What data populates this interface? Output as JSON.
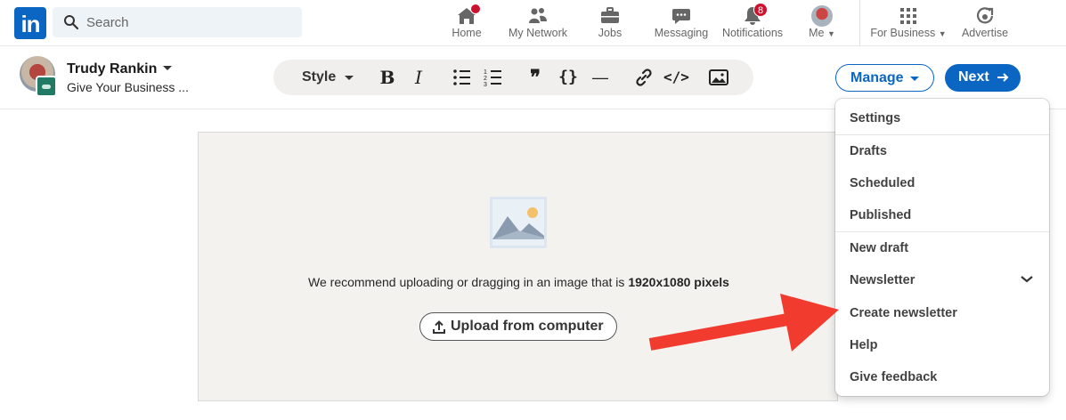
{
  "nav": {
    "logo_text": "in",
    "search_placeholder": "Search",
    "items": [
      {
        "label": "Home",
        "icon": "home-icon"
      },
      {
        "label": "My Network",
        "icon": "network-icon"
      },
      {
        "label": "Jobs",
        "icon": "briefcase-icon"
      },
      {
        "label": "Messaging",
        "icon": "message-icon"
      },
      {
        "label": "Notifications",
        "icon": "bell-icon",
        "badge": "8"
      },
      {
        "label": "Me",
        "icon": "avatar"
      },
      {
        "label": "For Business",
        "icon": "grid-icon"
      },
      {
        "label": "Advertise",
        "icon": "advertise-icon"
      }
    ]
  },
  "author": {
    "name": "Trudy Rankin",
    "subtitle": "Give Your Business ..."
  },
  "toolbar": {
    "style_label": "Style",
    "bold_glyph": "B",
    "italic_glyph": "I",
    "quote_glyph": "❞",
    "code_glyph": "{}",
    "divider_glyph": "—",
    "embed_glyph": "</>"
  },
  "header_actions": {
    "manage_label": "Manage",
    "next_label": "Next"
  },
  "canvas": {
    "recommend_text": "We recommend uploading or dragging in an image that is ",
    "recommend_bold": "1920x1080 pixels",
    "upload_label": "Upload from computer"
  },
  "menu": {
    "items": [
      "Settings",
      "Drafts",
      "Scheduled",
      "Published",
      "New draft",
      "Newsletter",
      "Create newsletter",
      "Help",
      "Give feedback"
    ]
  },
  "colors": {
    "brand": "#0a66c2",
    "badge": "#cb112d",
    "annotation_arrow": "#f23b2f"
  }
}
